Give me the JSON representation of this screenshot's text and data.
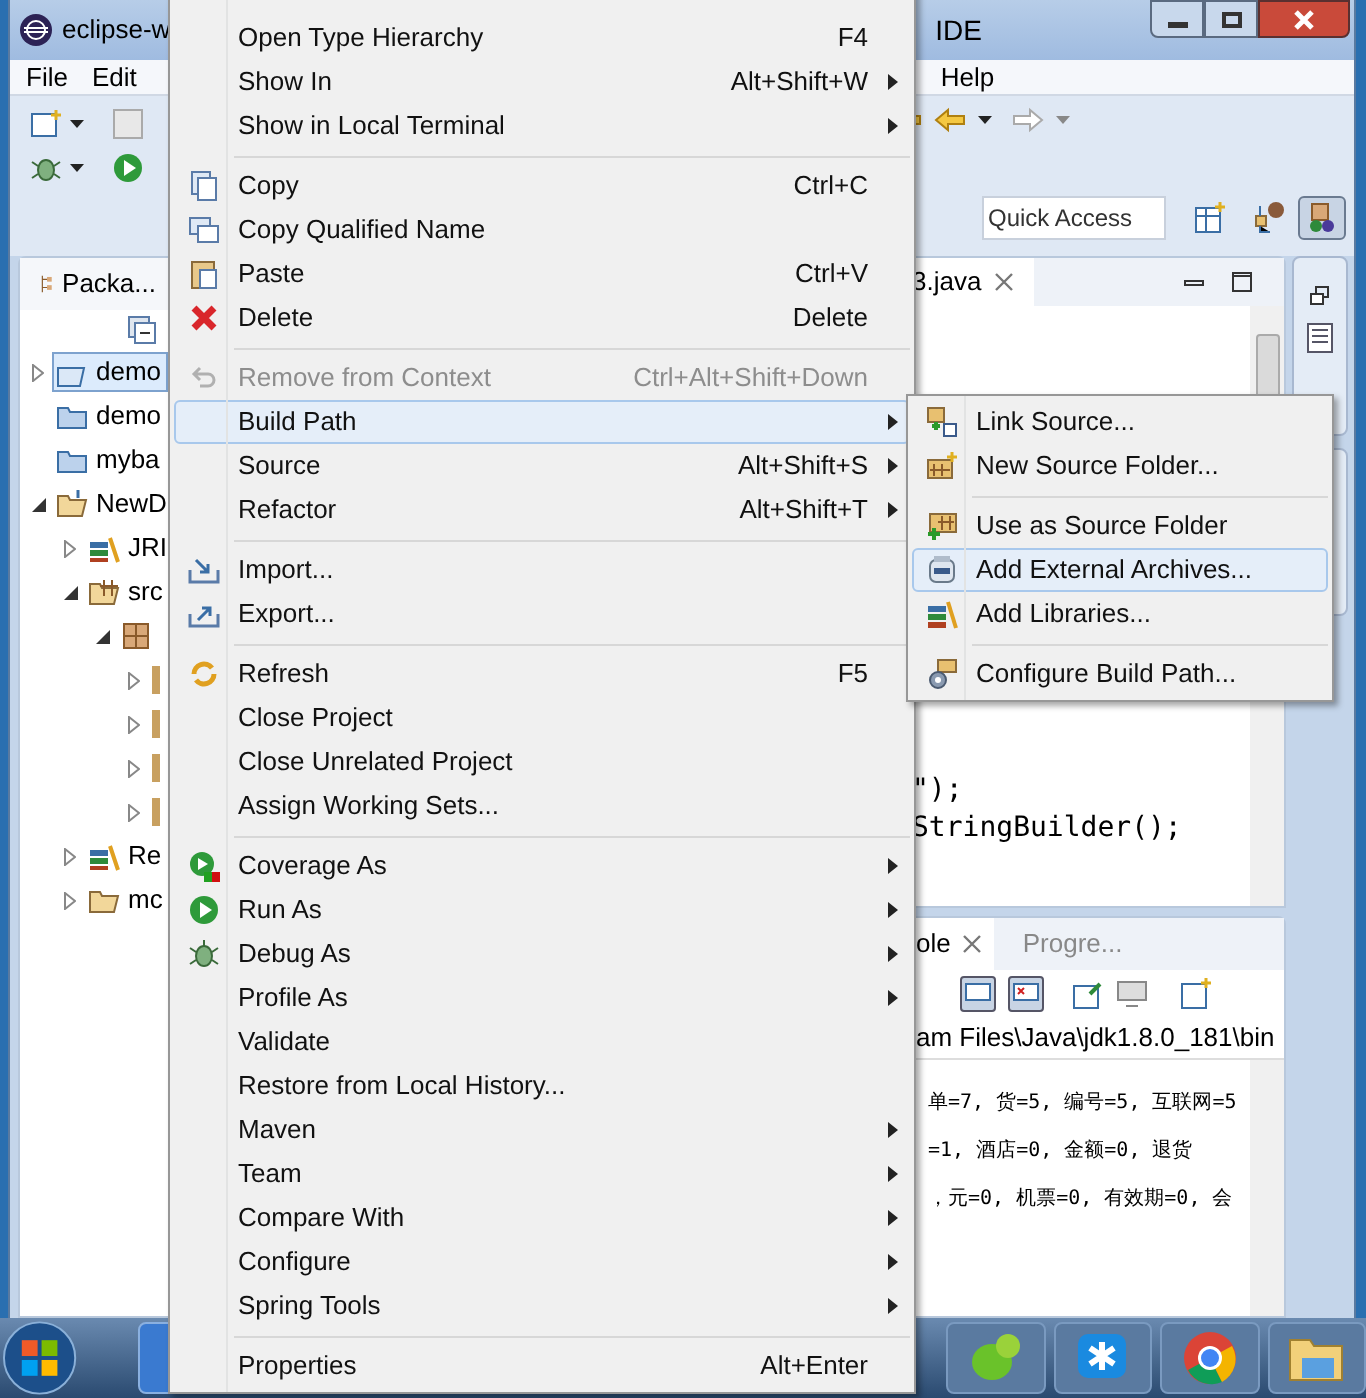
{
  "window": {
    "title": "eclipse-w",
    "title_tail": "IDE"
  },
  "menu_bar": [
    "File",
    "Edit",
    "Help"
  ],
  "quick_access": {
    "placeholder": "Quick Access"
  },
  "package_explorer": {
    "title": "Packa...",
    "tree": [
      {
        "label": "demo",
        "kind": "maven-project",
        "expanded": false,
        "selected": true
      },
      {
        "label": "demo",
        "kind": "closed-project",
        "selected": false
      },
      {
        "label": "myba",
        "kind": "closed-project",
        "selected": false
      },
      {
        "label": "NewD",
        "kind": "project",
        "expanded": true,
        "selected": false,
        "children": [
          {
            "label": "JRI",
            "kind": "library",
            "expanded": false,
            "selected": false
          },
          {
            "label": "src",
            "kind": "source-folder",
            "expanded": true,
            "selected": false,
            "children": [
              {
                "kind": "package",
                "expanded": true,
                "selected": false,
                "children": [
                  {
                    "kind": "file",
                    "expanded": false,
                    "selected": false
                  },
                  {
                    "kind": "file",
                    "expanded": false,
                    "selected": false
                  },
                  {
                    "kind": "file",
                    "expanded": false,
                    "selected": false
                  },
                  {
                    "kind": "file",
                    "expanded": false,
                    "selected": false
                  }
                ]
              }
            ]
          },
          {
            "label": "Re",
            "kind": "library",
            "expanded": false,
            "selected": false
          },
          {
            "label": "mc",
            "kind": "folder",
            "expanded": false,
            "selected": false
          }
        ]
      }
    ]
  },
  "editor": {
    "tab": "3.java",
    "code_lines": [
      "\");",
      "StringBuilder();"
    ]
  },
  "console": {
    "tabs": [
      {
        "label": "ole",
        "selected": true
      },
      {
        "label": "Progre...",
        "selected": false
      }
    ],
    "path": "am Files\\Java\\jdk1.8.0_181\\bin",
    "lines": [
      "单=7, 货=5, 编号=5, 互联网=5",
      "=1, 酒店=0, 金额=0, 退货",
      "，元=0, 机票=0, 有效期=0, 会"
    ]
  },
  "context_menu": {
    "items": [
      {
        "kind": "item",
        "label": "Open Type Hierarchy",
        "shortcut": "F4",
        "submenu": false,
        "disabled": false,
        "selected": false
      },
      {
        "kind": "item",
        "label": "Show In",
        "shortcut": "Alt+Shift+W",
        "submenu": true,
        "disabled": false,
        "selected": false
      },
      {
        "kind": "item",
        "label": "Show in Local Terminal",
        "submenu": true,
        "disabled": false,
        "selected": false
      },
      {
        "kind": "separator"
      },
      {
        "kind": "item",
        "label": "Copy",
        "shortcut": "Ctrl+C",
        "submenu": false,
        "disabled": false,
        "selected": false
      },
      {
        "kind": "item",
        "label": "Copy Qualified Name",
        "submenu": false,
        "disabled": false,
        "selected": false
      },
      {
        "kind": "item",
        "label": "Paste",
        "shortcut": "Ctrl+V",
        "submenu": false,
        "disabled": false,
        "selected": false
      },
      {
        "kind": "item",
        "label": "Delete",
        "shortcut": "Delete",
        "submenu": false,
        "disabled": false,
        "selected": false
      },
      {
        "kind": "separator"
      },
      {
        "kind": "item",
        "label": "Remove from Context",
        "shortcut": "Ctrl+Alt+Shift+Down",
        "submenu": false,
        "disabled": true,
        "selected": false
      },
      {
        "kind": "item",
        "label": "Build Path",
        "submenu": true,
        "disabled": false,
        "selected": true
      },
      {
        "kind": "item",
        "label": "Source",
        "shortcut": "Alt+Shift+S",
        "submenu": true,
        "disabled": false,
        "selected": false
      },
      {
        "kind": "item",
        "label": "Refactor",
        "shortcut": "Alt+Shift+T",
        "submenu": true,
        "disabled": false,
        "selected": false
      },
      {
        "kind": "separator"
      },
      {
        "kind": "item",
        "label": "Import...",
        "submenu": false,
        "disabled": false,
        "selected": false
      },
      {
        "kind": "item",
        "label": "Export...",
        "submenu": false,
        "disabled": false,
        "selected": false
      },
      {
        "kind": "separator"
      },
      {
        "kind": "item",
        "label": "Refresh",
        "shortcut": "F5",
        "submenu": false,
        "disabled": false,
        "selected": false
      },
      {
        "kind": "item",
        "label": "Close Project",
        "submenu": false,
        "disabled": false,
        "selected": false
      },
      {
        "kind": "item",
        "label": "Close Unrelated Project",
        "submenu": false,
        "disabled": false,
        "selected": false
      },
      {
        "kind": "item",
        "label": "Assign Working Sets...",
        "submenu": false,
        "disabled": false,
        "selected": false
      },
      {
        "kind": "separator"
      },
      {
        "kind": "item",
        "label": "Coverage As",
        "submenu": true,
        "disabled": false,
        "selected": false
      },
      {
        "kind": "item",
        "label": "Run As",
        "submenu": true,
        "disabled": false,
        "selected": false
      },
      {
        "kind": "item",
        "label": "Debug As",
        "submenu": true,
        "disabled": false,
        "selected": false
      },
      {
        "kind": "item",
        "label": "Profile As",
        "submenu": true,
        "disabled": false,
        "selected": false
      },
      {
        "kind": "item",
        "label": "Validate",
        "submenu": false,
        "disabled": false,
        "selected": false
      },
      {
        "kind": "item",
        "label": "Restore from Local History...",
        "submenu": false,
        "disabled": false,
        "selected": false
      },
      {
        "kind": "item",
        "label": "Maven",
        "submenu": true,
        "disabled": false,
        "selected": false
      },
      {
        "kind": "item",
        "label": "Team",
        "submenu": true,
        "disabled": false,
        "selected": false
      },
      {
        "kind": "item",
        "label": "Compare With",
        "submenu": true,
        "disabled": false,
        "selected": false
      },
      {
        "kind": "item",
        "label": "Configure",
        "submenu": true,
        "disabled": false,
        "selected": false
      },
      {
        "kind": "item",
        "label": "Spring Tools",
        "submenu": true,
        "disabled": false,
        "selected": false
      },
      {
        "kind": "separator"
      },
      {
        "kind": "item",
        "label": "Properties",
        "shortcut": "Alt+Enter",
        "submenu": false,
        "disabled": false,
        "selected": false
      }
    ]
  },
  "build_path_menu": {
    "items": [
      {
        "kind": "item",
        "label": "Link Source...",
        "selected": false
      },
      {
        "kind": "item",
        "label": "New Source Folder...",
        "selected": false
      },
      {
        "kind": "separator"
      },
      {
        "kind": "item",
        "label": "Use as Source Folder",
        "selected": false
      },
      {
        "kind": "item",
        "label": "Add External Archives...",
        "selected": true
      },
      {
        "kind": "item",
        "label": "Add Libraries...",
        "selected": false
      },
      {
        "kind": "separator"
      },
      {
        "kind": "item",
        "label": "Configure Build Path...",
        "selected": false
      }
    ]
  }
}
